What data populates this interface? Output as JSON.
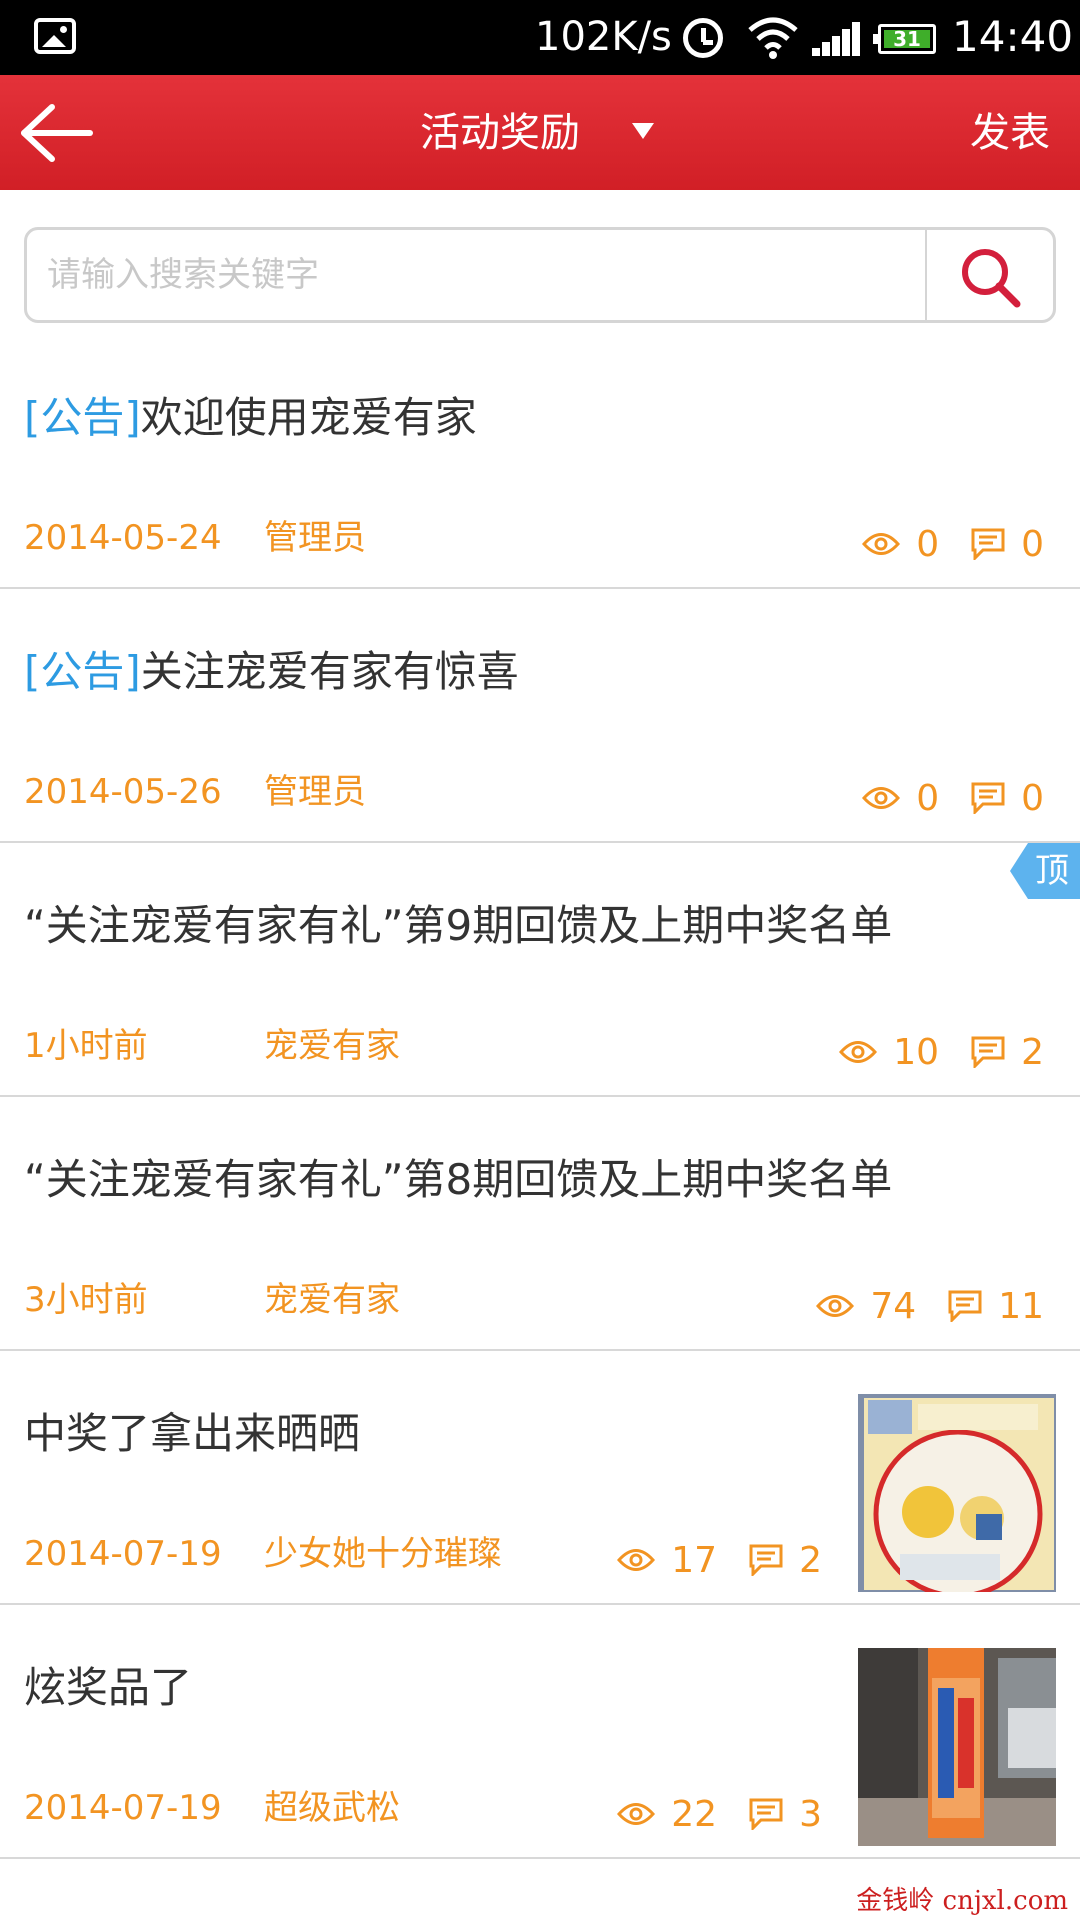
{
  "status_bar": {
    "net_speed": "102K/s",
    "battery": "31",
    "time": "14:40"
  },
  "header": {
    "title": "活动奖励",
    "action": "发表"
  },
  "search": {
    "placeholder": "请输入搜索关键字"
  },
  "colors": {
    "header_red": "#d9262c",
    "meta_orange": "#f29422",
    "tag_blue": "#2d9be2",
    "badge_blue": "#5db3ee"
  },
  "posts": [
    {
      "tag": "[公告]",
      "title": "欢迎使用宠爱有家",
      "date": "2014-05-24",
      "author": "管理员",
      "views": "0",
      "comments": "0"
    },
    {
      "tag": "[公告]",
      "title": "关注宠爱有家有惊喜",
      "date": "2014-05-26",
      "author": "管理员",
      "views": "0",
      "comments": "0"
    },
    {
      "title": "“关注宠爱有家有礼”第9期回馈及上期中奖名单",
      "date": "1小时前",
      "author": "宠爱有家",
      "views": "10",
      "comments": "2",
      "badge": "顶"
    },
    {
      "title": "“关注宠爱有家有礼”第8期回馈及上期中奖名单",
      "date": "3小时前",
      "author": "宠爱有家",
      "views": "74",
      "comments": "11"
    },
    {
      "title": "中奖了拿出来晒晒",
      "date": "2014-07-19",
      "author": "少女她十分璀璨",
      "views": "17",
      "comments": "2"
    },
    {
      "title": "炫奖品了",
      "date": "2014-07-19",
      "author": "超级武松",
      "views": "22",
      "comments": "3"
    }
  ],
  "watermark": "金钱岭 cnjxl.com"
}
